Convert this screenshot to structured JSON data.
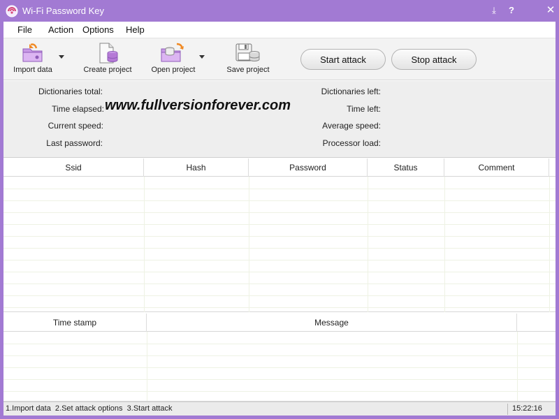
{
  "window": {
    "title": "Wi-Fi Password Key"
  },
  "titlebar_buttons": {
    "minimize": "⤓",
    "help": "?",
    "close": "✕"
  },
  "menu": [
    "File",
    "Action",
    "Options",
    "Help"
  ],
  "toolbar": {
    "import_data": "Import data",
    "create_project": "Create project",
    "open_project": "Open project",
    "save_project": "Save project",
    "start_attack": "Start attack",
    "stop_attack": "Stop attack"
  },
  "stats": {
    "dictionaries_total": "Dictionaries total:",
    "time_elapsed": "Time elapsed:",
    "current_speed": "Current speed:",
    "last_password": "Last password:",
    "dictionaries_left": "Dictionaries left:",
    "time_left": "Time left:",
    "average_speed": "Average speed:",
    "processor_load": "Processor load:",
    "watermark": "www.fullversionforever.com"
  },
  "results_table": {
    "columns": [
      "Ssid",
      "Hash",
      "Password",
      "Status",
      "Comment"
    ]
  },
  "log_table": {
    "columns": [
      "Time stamp",
      "Message"
    ]
  },
  "statusbar": {
    "steps": "1.Import data  2.Set attack options  3.Start attack",
    "time": "15:22:16"
  },
  "colors": {
    "frame": "#a27ad3",
    "accent_orange": "#f08a24",
    "accent_purple": "#b57ad6"
  }
}
